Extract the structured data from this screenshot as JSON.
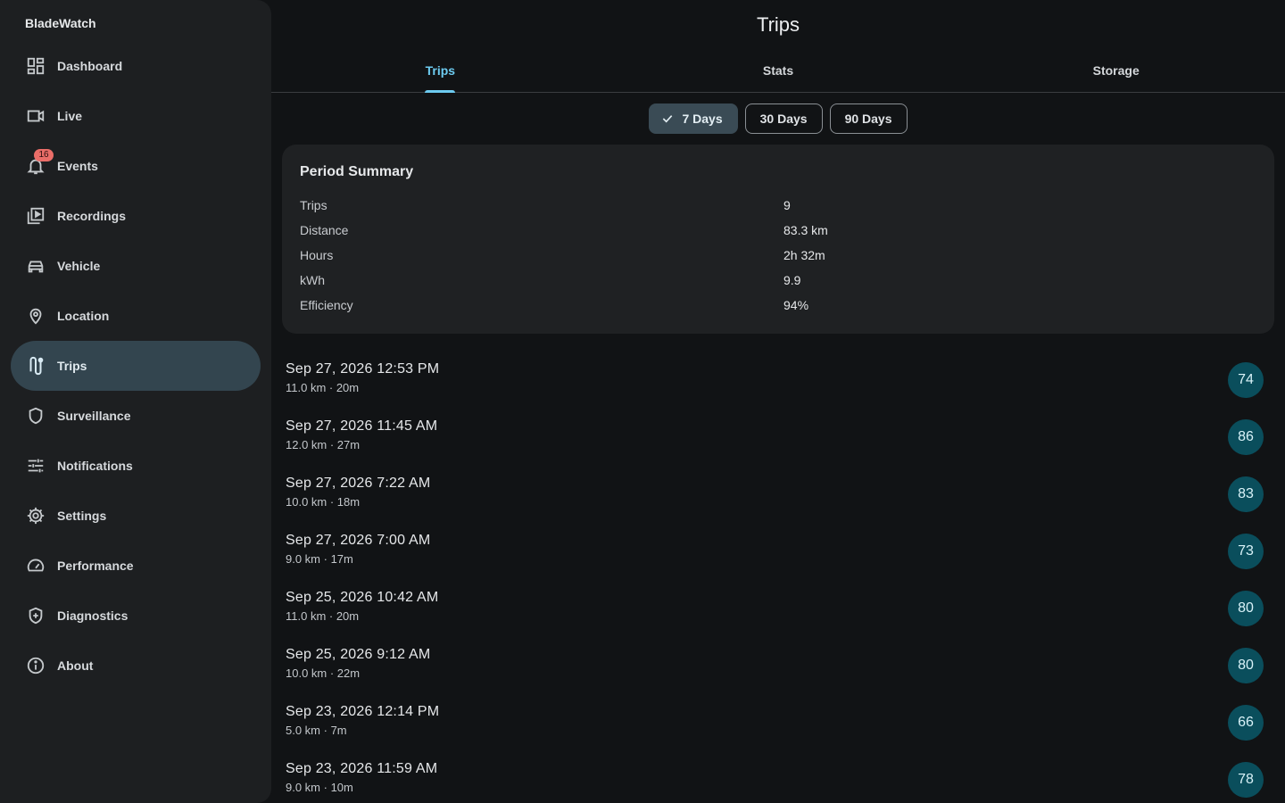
{
  "app": {
    "name": "BladeWatch"
  },
  "sidebar": {
    "items": [
      {
        "label": "Dashboard",
        "icon": "dashboard-icon"
      },
      {
        "label": "Live",
        "icon": "videocam-icon"
      },
      {
        "label": "Events",
        "icon": "bell-icon",
        "badge": "16"
      },
      {
        "label": "Recordings",
        "icon": "video-library-icon"
      },
      {
        "label": "Vehicle",
        "icon": "car-icon"
      },
      {
        "label": "Location",
        "icon": "pin-icon"
      },
      {
        "label": "Trips",
        "icon": "route-icon",
        "active": true
      },
      {
        "label": "Surveillance",
        "icon": "shield-icon"
      },
      {
        "label": "Notifications",
        "icon": "tune-icon"
      },
      {
        "label": "Settings",
        "icon": "gear-icon"
      },
      {
        "label": "Performance",
        "icon": "speed-icon"
      },
      {
        "label": "Diagnostics",
        "icon": "health-shield-icon"
      },
      {
        "label": "About",
        "icon": "info-icon"
      }
    ]
  },
  "header": {
    "title": "Trips"
  },
  "tabs": [
    {
      "label": "Trips",
      "active": true
    },
    {
      "label": "Stats"
    },
    {
      "label": "Storage"
    }
  ],
  "filters": [
    {
      "label": "7 Days",
      "selected": true
    },
    {
      "label": "30 Days"
    },
    {
      "label": "90 Days"
    }
  ],
  "summary": {
    "title": "Period Summary",
    "rows": [
      {
        "key": "Trips",
        "value": "9"
      },
      {
        "key": "Distance",
        "value": "83.3 km"
      },
      {
        "key": "Hours",
        "value": "2h 32m"
      },
      {
        "key": "kWh",
        "value": "9.9"
      },
      {
        "key": "Efficiency",
        "value": "94%"
      }
    ]
  },
  "trips": [
    {
      "date": "Sep 27, 2026 12:53 PM",
      "detail": "11.0 km · 20m",
      "score": "74"
    },
    {
      "date": "Sep 27, 2026 11:45 AM",
      "detail": "12.0 km · 27m",
      "score": "86"
    },
    {
      "date": "Sep 27, 2026 7:22 AM",
      "detail": "10.0 km · 18m",
      "score": "83"
    },
    {
      "date": "Sep 27, 2026 7:00 AM",
      "detail": "9.0 km · 17m",
      "score": "73"
    },
    {
      "date": "Sep 25, 2026 10:42 AM",
      "detail": "11.0 km · 20m",
      "score": "80"
    },
    {
      "date": "Sep 25, 2026 9:12 AM",
      "detail": "10.0 km · 22m",
      "score": "80"
    },
    {
      "date": "Sep 23, 2026 12:14 PM",
      "detail": "5.0 km · 7m",
      "score": "66"
    },
    {
      "date": "Sep 23, 2026 11:59 AM",
      "detail": "9.0 km · 10m",
      "score": "78"
    }
  ],
  "colors": {
    "accent": "#6dcbf0",
    "active_nav": "#33454f",
    "score_bg": "#0a4e5c",
    "badge": "#ea6d68"
  }
}
